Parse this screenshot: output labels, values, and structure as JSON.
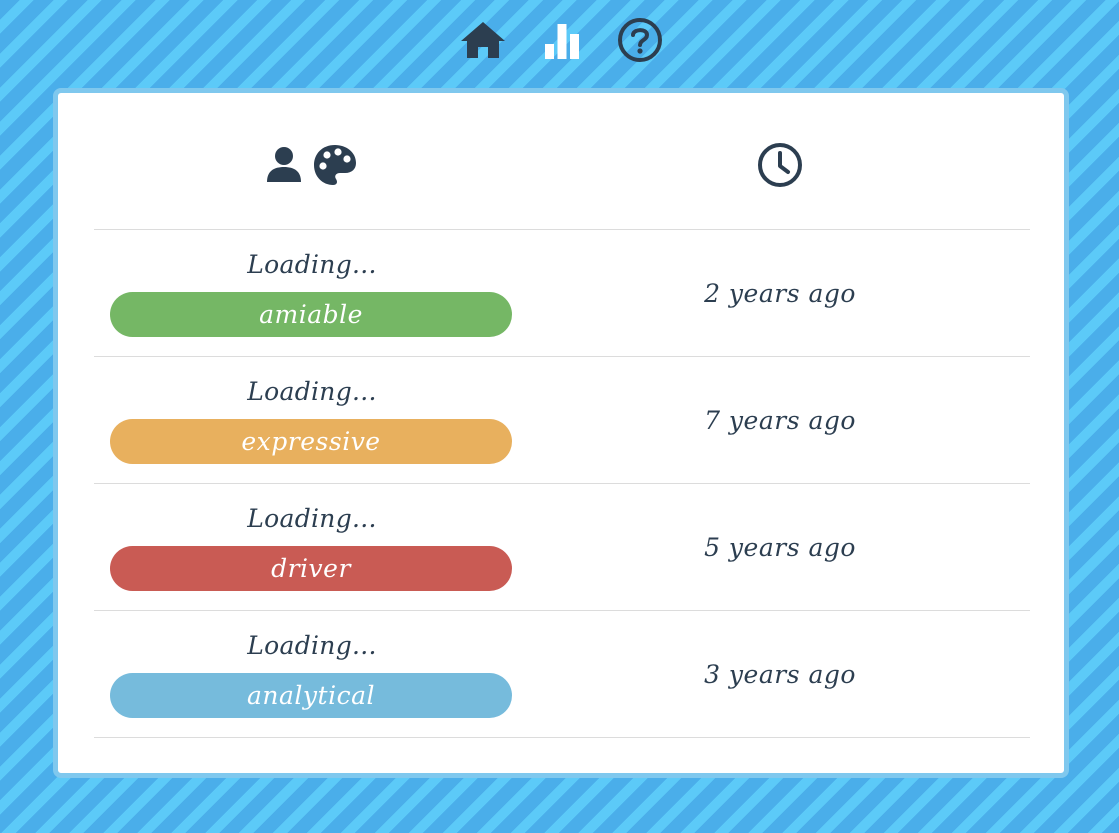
{
  "nav": {
    "items": [
      {
        "icon": "home-icon"
      },
      {
        "icon": "bar-chart-icon"
      },
      {
        "icon": "help-icon"
      }
    ]
  },
  "table": {
    "header": {
      "left_icons": [
        "user-icon",
        "palette-icon"
      ],
      "right_icon": "clock-icon"
    },
    "rows": [
      {
        "name": "Loading...",
        "style": "amiable",
        "style_color": "#75b765",
        "time": "2 years ago"
      },
      {
        "name": "Loading...",
        "style": "expressive",
        "style_color": "#e8b05e",
        "time": "7 years ago"
      },
      {
        "name": "Loading...",
        "style": "driver",
        "style_color": "#c95b54",
        "time": "5 years ago"
      },
      {
        "name": "Loading...",
        "style": "analytical",
        "style_color": "#76bbdc",
        "time": "3 years ago"
      }
    ]
  },
  "colors": {
    "text": "#2c3e50",
    "background": "#4aaeea",
    "stripe": "#5ccaf8",
    "card_border": "#7fc8ee",
    "nav_stats_icon": "#ffffff"
  }
}
